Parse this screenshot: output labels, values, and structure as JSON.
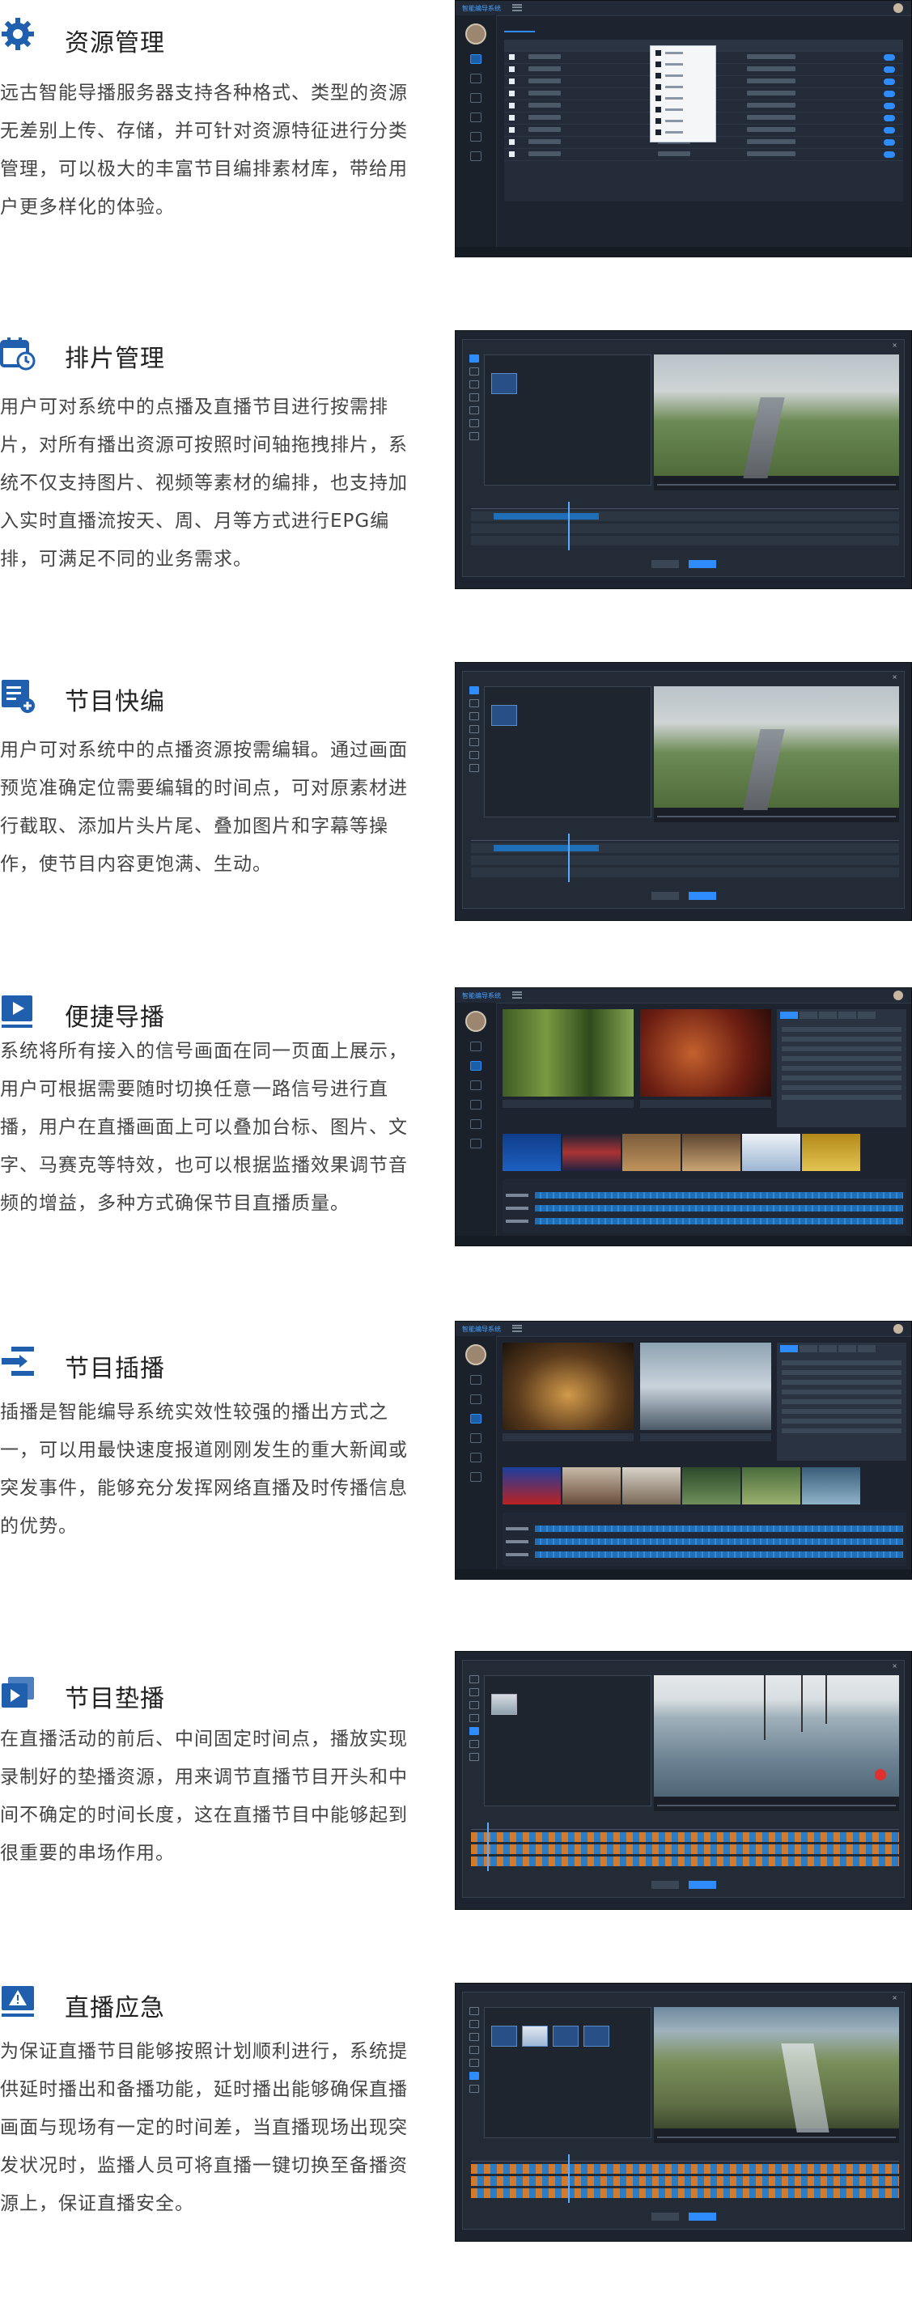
{
  "features": [
    {
      "icon": "gear-icon",
      "title": "资源管理",
      "description": "远古智能导播服务器支持各种格式、类型的资源无差别上传、存储，并可针对资源特征进行分类管理，可以极大的丰富节目编排素材库，带给用户更多样化的体验。"
    },
    {
      "icon": "calendar-clock-icon",
      "title": "排片管理",
      "description": "用户可对系统中的点播及直播节目进行按需排片，对所有播出资源可按照时间轴拖拽排片，系统不仅支持图片、视频等素材的编排，也支持加入实时直播流按天、周、月等方式进行EPG编排，可满足不同的业务需求。"
    },
    {
      "icon": "list-add-icon",
      "title": "节目快编",
      "description": "用户可对系统中的点播资源按需编辑。通过画面预览准确定位需要编辑的时间点，可对原素材进行截取、添加片头片尾、叠加图片和字幕等操作，使节目内容更饱满、生动。"
    },
    {
      "icon": "play-icon",
      "title": "便捷导播",
      "description": "系统将所有接入的信号画面在同一页面上展示，用户可根据需要随时切换任意一路信号进行直播，用户在直播画面上可以叠加台标、图片、文字、马赛克等特效，也可以根据监播效果调节音频的增益，多种方式确保节目直播质量。"
    },
    {
      "icon": "insert-icon",
      "title": "节目插播",
      "description": "插播是智能编导系统实效性较强的播出方式之一，可以用最快速度报道刚刚发生的重大新闻或突发事件，能够充分发挥网络直播及时传播信息的优势。"
    },
    {
      "icon": "layered-play-icon",
      "title": "节目垫播",
      "description": "在直播活动的前后、中间固定时间点，播放实现录制好的垫播资源，用来调节直播节目开头和中间不确定的时间长度，这在直播节目中能够起到很重要的串场作用。"
    },
    {
      "icon": "monitor-warning-icon",
      "title": "直播应急",
      "description": "为保证直播节目能够按照计划顺利进行，系统提供延时播出和备播功能，延时播出能够确保直播画面与现场有一定的时间差，当直播现场出现突发状况时，监播人员可将直播一键切换至备播资源上，保证直播安全。"
    }
  ],
  "colors": {
    "accent": "#2f8cff",
    "icon": "#1f5fae",
    "screen_bg": "#1d2430"
  }
}
